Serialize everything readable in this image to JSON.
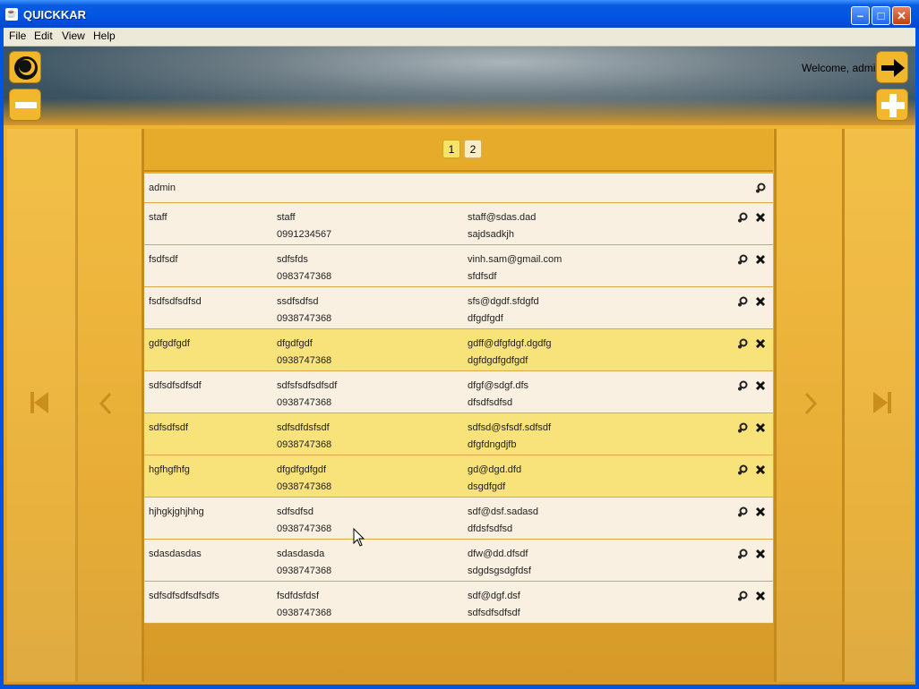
{
  "window": {
    "title": "QUICKKAR",
    "app_icon_glyph": "☕"
  },
  "menu": [
    "File",
    "Edit",
    "View",
    "Help"
  ],
  "header": {
    "welcome": "Welcome, admin"
  },
  "pagination": {
    "pages": [
      "1",
      "2"
    ],
    "active": "1"
  },
  "admin_row": {
    "name": "admin"
  },
  "rows": [
    {
      "username": "staff",
      "name": "staff",
      "phone": "0991234567",
      "email": "staff@sdas.dad",
      "address": "sajdsadkjh",
      "highlight": false
    },
    {
      "username": "fsdfsdf",
      "name": "sdfsfds",
      "phone": "0983747368",
      "email": "vinh.sam@gmail.com",
      "address": "sfdfsdf",
      "highlight": false
    },
    {
      "username": "fsdfsdfsdfsd",
      "name": "ssdfsdfsd",
      "phone": "0938747368",
      "email": "sfs@dgdf.sfdgfd",
      "address": "dfgdfgdf",
      "highlight": false
    },
    {
      "username": "gdfgdfgdf",
      "name": "dfgdfgdf",
      "phone": "0938747368",
      "email": "gdff@dfgfdgf.dgdfg",
      "address": "dgfdgdfgdfgdf",
      "highlight": true
    },
    {
      "username": "sdfsdfsdfsdf",
      "name": "sdfsfsdfsdfsdf",
      "phone": "0938747368",
      "email": "dfgf@sdgf.dfs",
      "address": "dfsdfsdfsd",
      "highlight": false
    },
    {
      "username": "sdfsdfsdf",
      "name": "sdfsdfdsfsdf",
      "phone": "0938747368",
      "email": "sdfsd@sfsdf.sdfsdf",
      "address": "dfgfdngdjfb",
      "highlight": true
    },
    {
      "username": "hgfhgfhfg",
      "name": "dfgdfgdfgdf",
      "phone": "0938747368",
      "email": "gd@dgd.dfd",
      "address": "dsgdfgdf",
      "highlight": true
    },
    {
      "username": "hjhgkjghjhhg",
      "name": "sdfsdfsd",
      "phone": "0938747368",
      "email": "sdf@dsf.sadasd",
      "address": "dfdsfsdfsd",
      "highlight": false
    },
    {
      "username": "sdasdasdas",
      "name": "sdasdasda",
      "phone": "0938747368",
      "email": "dfw@dd.dfsdf",
      "address": "sdgdsgsdgfdsf",
      "highlight": false
    },
    {
      "username": "sdfsdfsdfsdfsdfs",
      "name": "fsdfdsfdsf",
      "phone": "0938747368",
      "email": "sdf@dgf.dsf",
      "address": "sdfsdfsdfsdf",
      "highlight": false
    }
  ],
  "icons": {
    "logout": "arrow-right-icon",
    "logo": "logo-icon",
    "remove": "minus-icon",
    "add": "plus-icon",
    "edit": "gear-icon",
    "delete": "close-icon",
    "first": "first-page-icon",
    "prev": "chevron-left-icon",
    "next": "chevron-right-icon",
    "last": "last-page-icon"
  },
  "colors": {
    "accent": "#f1b82d",
    "row_highlight": "#f8e27a",
    "row_normal": "#f9f0e1",
    "titlebar": "#0054e3"
  }
}
